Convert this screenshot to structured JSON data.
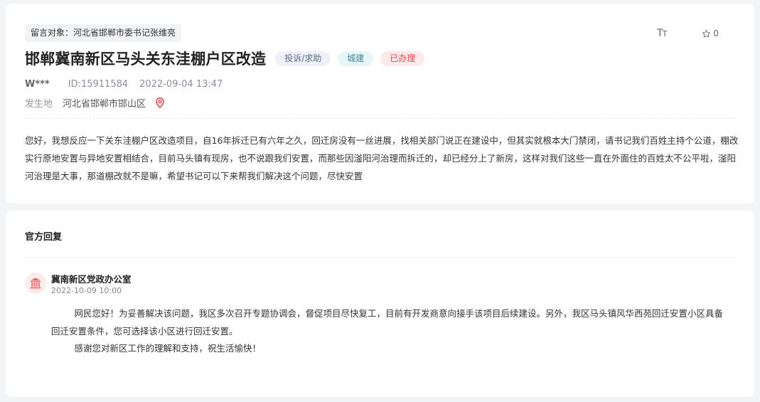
{
  "post": {
    "target": "留言对象：河北省邯郸市委书记张维亮",
    "title": "邯郸冀南新区马头关东洼棚户区改造",
    "tags": {
      "type": "投诉/求助",
      "category": "城建",
      "status": "已办理"
    },
    "user": "W***",
    "id": "ID:15911584",
    "time": "2022-09-04 13:47",
    "location_label": "发生地",
    "location": "河北省邯郸市邯山区",
    "star_count": "0",
    "content": "您好，我想反应一下关东洼棚户区改造项目，自16年拆迁已有六年之久，回迁房没有一丝进展，找相关部门说正在建设中，但其实就根本大门禁闭，请书记我们百姓主持个公道，棚改实行原地安置与异地安置相结合，目前马头镇有现房，也不说跟我们安置，而那些因滏阳河治理而拆迁的，却已经分上了新房，这样对我们这些一直在外面住的百姓太不公平啦，滏阳河治理是大事，那道棚改就不是嘛，希望书记可以下来帮我们解决这个问题，尽快安置"
  },
  "icons": {
    "font_size": "font-size-icon",
    "star": "star-icon",
    "location_pin": "location-pin-icon",
    "government": "government-building-icon"
  },
  "colors": {
    "status_red": "#e0474e",
    "category_teal": "#3c8c99",
    "type_slate": "#5b6b87",
    "pin_red": "#e84b4b"
  },
  "reply": {
    "section_title": "官方回复",
    "office": "冀南新区党政办公室",
    "time": "2022-10-09 10:00",
    "paragraph1": "网民您好！为妥善解决该问题，我区多次召开专题协调会，督促项目尽快复工，目前有开发商意向接手该项目后续建设。另外，我区马头镇风华西苑回迁安置小区具备",
    "paragraph1_cont": "回迁安置条件，您可选择该小区进行回迁安置。",
    "paragraph2": "感谢您对新区工作的理解和支持，祝生活愉快！"
  }
}
